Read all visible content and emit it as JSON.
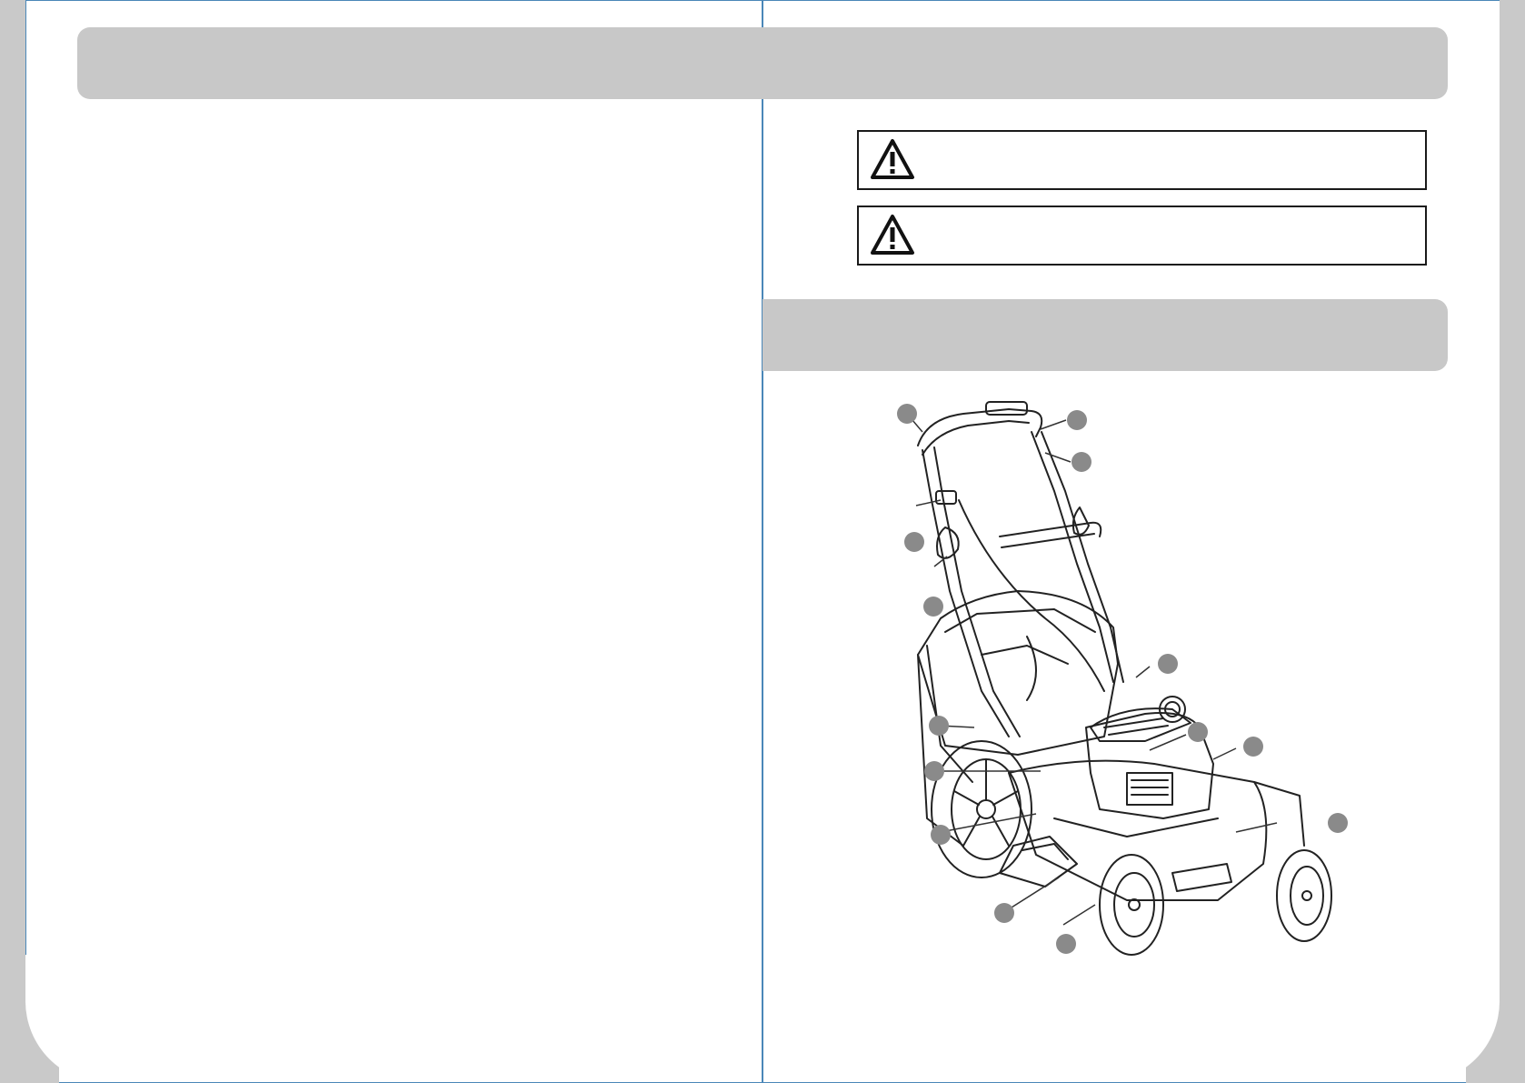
{
  "header": {
    "title": ""
  },
  "warnings": [
    {
      "icon": "warning-triangle-icon",
      "text": ""
    },
    {
      "icon": "warning-triangle-icon",
      "text": ""
    }
  ],
  "section": {
    "title": ""
  },
  "diagram": {
    "subject": "lawn-mower",
    "callouts": [
      "",
      "",
      "",
      "",
      "",
      "",
      "",
      "",
      "",
      "",
      "",
      "",
      "",
      ""
    ]
  },
  "colors": {
    "frame_line": "#4a87b8",
    "bar_gray": "#c8c8c8",
    "callout_gray": "#8a8a8a",
    "side_tab": "#c9c9c9"
  }
}
